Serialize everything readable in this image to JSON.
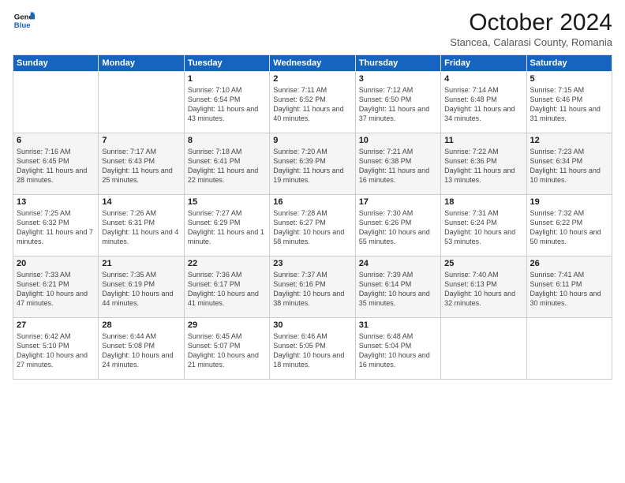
{
  "logo": {
    "line1": "General",
    "line2": "Blue"
  },
  "header": {
    "title": "October 2024",
    "subtitle": "Stancea, Calarasi County, Romania"
  },
  "weekdays": [
    "Sunday",
    "Monday",
    "Tuesday",
    "Wednesday",
    "Thursday",
    "Friday",
    "Saturday"
  ],
  "weeks": [
    [
      {
        "day": "",
        "info": ""
      },
      {
        "day": "",
        "info": ""
      },
      {
        "day": "1",
        "info": "Sunrise: 7:10 AM\nSunset: 6:54 PM\nDaylight: 11 hours and 43 minutes."
      },
      {
        "day": "2",
        "info": "Sunrise: 7:11 AM\nSunset: 6:52 PM\nDaylight: 11 hours and 40 minutes."
      },
      {
        "day": "3",
        "info": "Sunrise: 7:12 AM\nSunset: 6:50 PM\nDaylight: 11 hours and 37 minutes."
      },
      {
        "day": "4",
        "info": "Sunrise: 7:14 AM\nSunset: 6:48 PM\nDaylight: 11 hours and 34 minutes."
      },
      {
        "day": "5",
        "info": "Sunrise: 7:15 AM\nSunset: 6:46 PM\nDaylight: 11 hours and 31 minutes."
      }
    ],
    [
      {
        "day": "6",
        "info": "Sunrise: 7:16 AM\nSunset: 6:45 PM\nDaylight: 11 hours and 28 minutes."
      },
      {
        "day": "7",
        "info": "Sunrise: 7:17 AM\nSunset: 6:43 PM\nDaylight: 11 hours and 25 minutes."
      },
      {
        "day": "8",
        "info": "Sunrise: 7:18 AM\nSunset: 6:41 PM\nDaylight: 11 hours and 22 minutes."
      },
      {
        "day": "9",
        "info": "Sunrise: 7:20 AM\nSunset: 6:39 PM\nDaylight: 11 hours and 19 minutes."
      },
      {
        "day": "10",
        "info": "Sunrise: 7:21 AM\nSunset: 6:38 PM\nDaylight: 11 hours and 16 minutes."
      },
      {
        "day": "11",
        "info": "Sunrise: 7:22 AM\nSunset: 6:36 PM\nDaylight: 11 hours and 13 minutes."
      },
      {
        "day": "12",
        "info": "Sunrise: 7:23 AM\nSunset: 6:34 PM\nDaylight: 11 hours and 10 minutes."
      }
    ],
    [
      {
        "day": "13",
        "info": "Sunrise: 7:25 AM\nSunset: 6:32 PM\nDaylight: 11 hours and 7 minutes."
      },
      {
        "day": "14",
        "info": "Sunrise: 7:26 AM\nSunset: 6:31 PM\nDaylight: 11 hours and 4 minutes."
      },
      {
        "day": "15",
        "info": "Sunrise: 7:27 AM\nSunset: 6:29 PM\nDaylight: 11 hours and 1 minute."
      },
      {
        "day": "16",
        "info": "Sunrise: 7:28 AM\nSunset: 6:27 PM\nDaylight: 10 hours and 58 minutes."
      },
      {
        "day": "17",
        "info": "Sunrise: 7:30 AM\nSunset: 6:26 PM\nDaylight: 10 hours and 55 minutes."
      },
      {
        "day": "18",
        "info": "Sunrise: 7:31 AM\nSunset: 6:24 PM\nDaylight: 10 hours and 53 minutes."
      },
      {
        "day": "19",
        "info": "Sunrise: 7:32 AM\nSunset: 6:22 PM\nDaylight: 10 hours and 50 minutes."
      }
    ],
    [
      {
        "day": "20",
        "info": "Sunrise: 7:33 AM\nSunset: 6:21 PM\nDaylight: 10 hours and 47 minutes."
      },
      {
        "day": "21",
        "info": "Sunrise: 7:35 AM\nSunset: 6:19 PM\nDaylight: 10 hours and 44 minutes."
      },
      {
        "day": "22",
        "info": "Sunrise: 7:36 AM\nSunset: 6:17 PM\nDaylight: 10 hours and 41 minutes."
      },
      {
        "day": "23",
        "info": "Sunrise: 7:37 AM\nSunset: 6:16 PM\nDaylight: 10 hours and 38 minutes."
      },
      {
        "day": "24",
        "info": "Sunrise: 7:39 AM\nSunset: 6:14 PM\nDaylight: 10 hours and 35 minutes."
      },
      {
        "day": "25",
        "info": "Sunrise: 7:40 AM\nSunset: 6:13 PM\nDaylight: 10 hours and 32 minutes."
      },
      {
        "day": "26",
        "info": "Sunrise: 7:41 AM\nSunset: 6:11 PM\nDaylight: 10 hours and 30 minutes."
      }
    ],
    [
      {
        "day": "27",
        "info": "Sunrise: 6:42 AM\nSunset: 5:10 PM\nDaylight: 10 hours and 27 minutes."
      },
      {
        "day": "28",
        "info": "Sunrise: 6:44 AM\nSunset: 5:08 PM\nDaylight: 10 hours and 24 minutes."
      },
      {
        "day": "29",
        "info": "Sunrise: 6:45 AM\nSunset: 5:07 PM\nDaylight: 10 hours and 21 minutes."
      },
      {
        "day": "30",
        "info": "Sunrise: 6:46 AM\nSunset: 5:05 PM\nDaylight: 10 hours and 18 minutes."
      },
      {
        "day": "31",
        "info": "Sunrise: 6:48 AM\nSunset: 5:04 PM\nDaylight: 10 hours and 16 minutes."
      },
      {
        "day": "",
        "info": ""
      },
      {
        "day": "",
        "info": ""
      }
    ]
  ]
}
